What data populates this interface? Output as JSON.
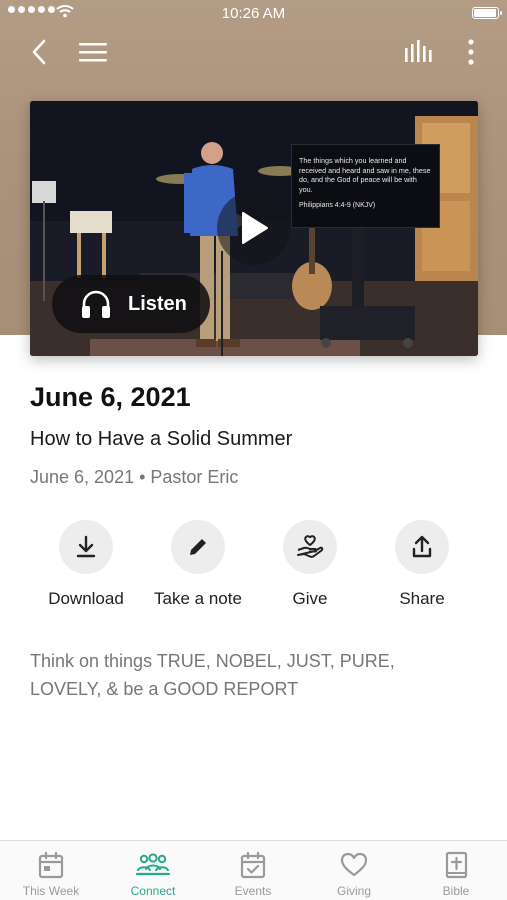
{
  "status_bar": {
    "time": "10:26 AM"
  },
  "top_nav": {
    "icons": [
      "back-chevron-icon",
      "hamburger-menu-icon",
      "audio-bars-icon",
      "more-vertical-icon"
    ]
  },
  "video": {
    "caption_text": "The things which you learned and received and heard and saw in me, these do, and the God of peace will be with you.",
    "caption_reference": "Philippians 4:4-9 (NKJV)",
    "listen_label": "Listen",
    "listen_icon": "headphones-icon",
    "play_icon": "play-icon"
  },
  "sermon": {
    "title": "June 6, 2021",
    "subtitle": "How to Have a Solid Summer",
    "meta": "June 6, 2021 • Pastor Eric",
    "description": "Think on things TRUE, NOBEL, JUST, PURE, LOVELY, & be a GOOD REPORT"
  },
  "actions": [
    {
      "label": "Download",
      "icon": "download-icon"
    },
    {
      "label": "Take a note",
      "icon": "pencil-icon"
    },
    {
      "label": "Give",
      "icon": "give-hand-heart-icon"
    },
    {
      "label": "Share",
      "icon": "share-icon"
    }
  ],
  "tab_bar": {
    "active_color": "#27a88a",
    "inactive_color": "#9a9a9a",
    "tabs": [
      {
        "label": "This Week",
        "icon": "calendar-icon",
        "active": false
      },
      {
        "label": "Connect",
        "icon": "people-icon",
        "active": true
      },
      {
        "label": "Events",
        "icon": "calendar-check-icon",
        "active": false
      },
      {
        "label": "Giving",
        "icon": "heart-icon",
        "active": false
      },
      {
        "label": "Bible",
        "icon": "bible-icon",
        "active": false
      }
    ]
  },
  "colors": {
    "header_background": "#aa9179",
    "accent": "#27a88a"
  }
}
